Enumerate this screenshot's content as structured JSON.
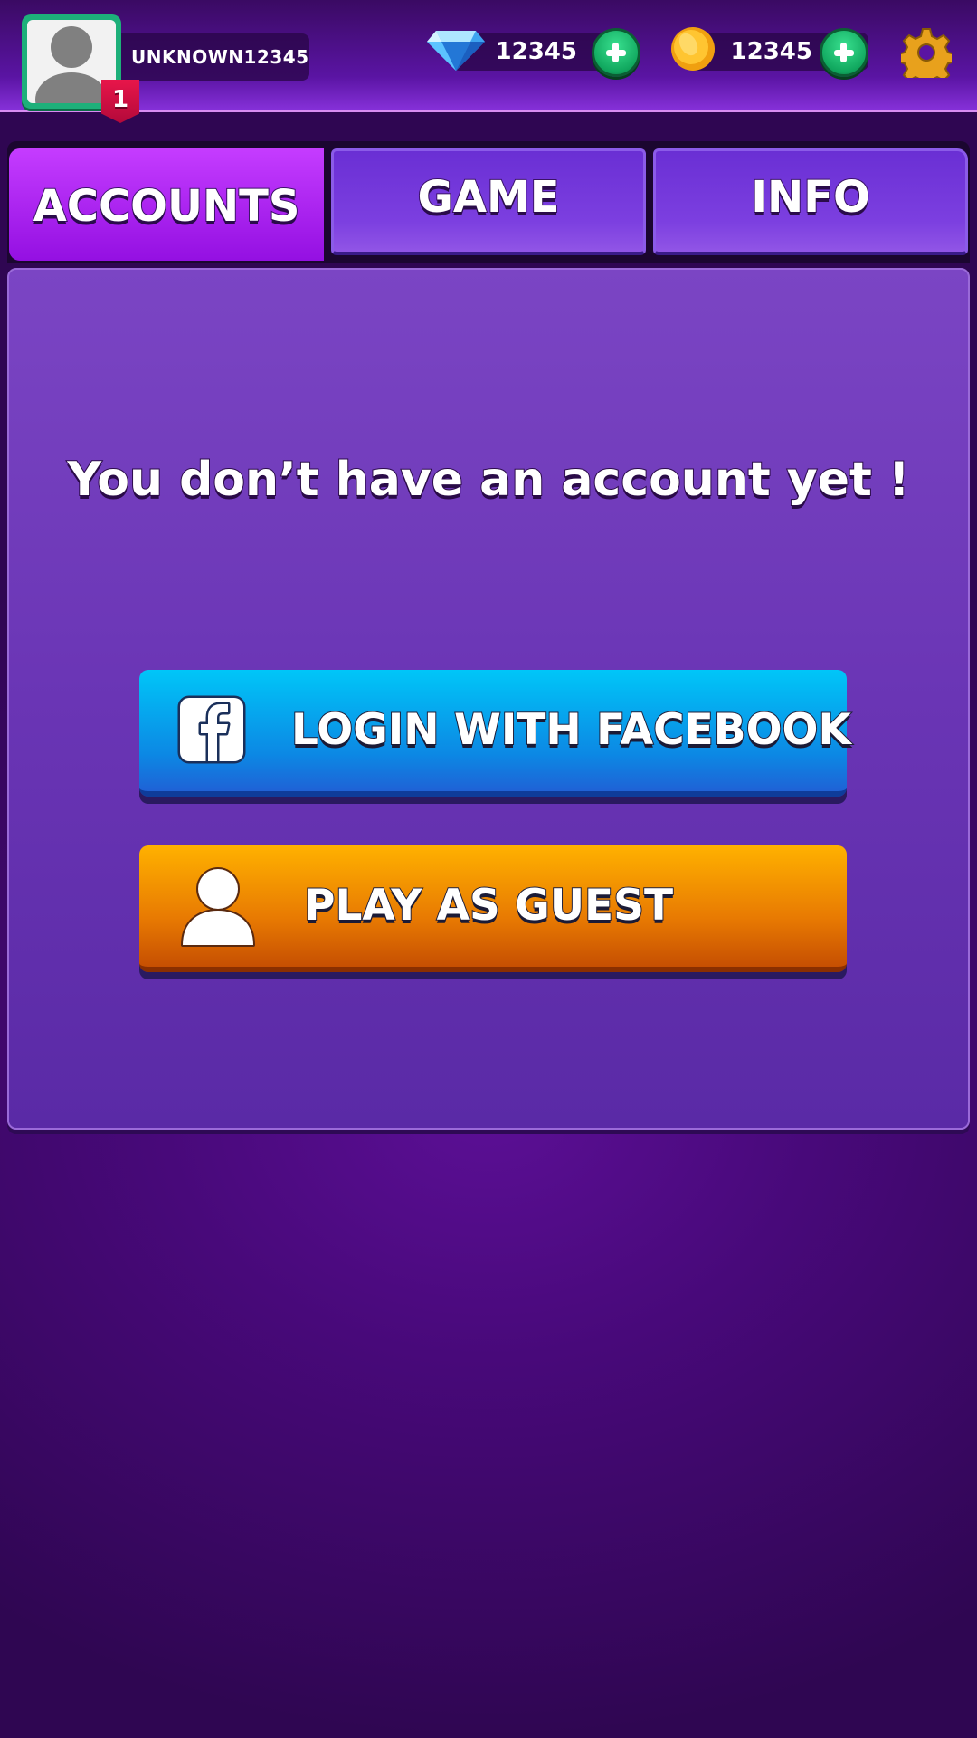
{
  "header": {
    "username": "UNKNOWN12345",
    "level": "1",
    "gems": "12345",
    "coins": "12345"
  },
  "tabs": [
    {
      "label": "ACCOUNTS",
      "active": true
    },
    {
      "label": "GAME",
      "active": false
    },
    {
      "label": "INFO",
      "active": false
    }
  ],
  "panel": {
    "message": "You don’t have an account yet !",
    "facebook_button": "LOGIN WITH FACEBOOK",
    "guest_button": "PLAY AS GUEST"
  },
  "icons": {
    "avatar": "default-avatar-icon",
    "gem": "diamond-icon",
    "coin": "coin-icon",
    "plus": "plus-icon",
    "settings": "gear-icon",
    "facebook": "facebook-icon",
    "guest": "user-icon"
  },
  "colors": {
    "accent_active_tab": "#b024f5",
    "facebook_button": "#0c88e4",
    "guest_button": "#e87a02",
    "plus_button": "#11a85f",
    "level_badge": "#d3104a"
  }
}
